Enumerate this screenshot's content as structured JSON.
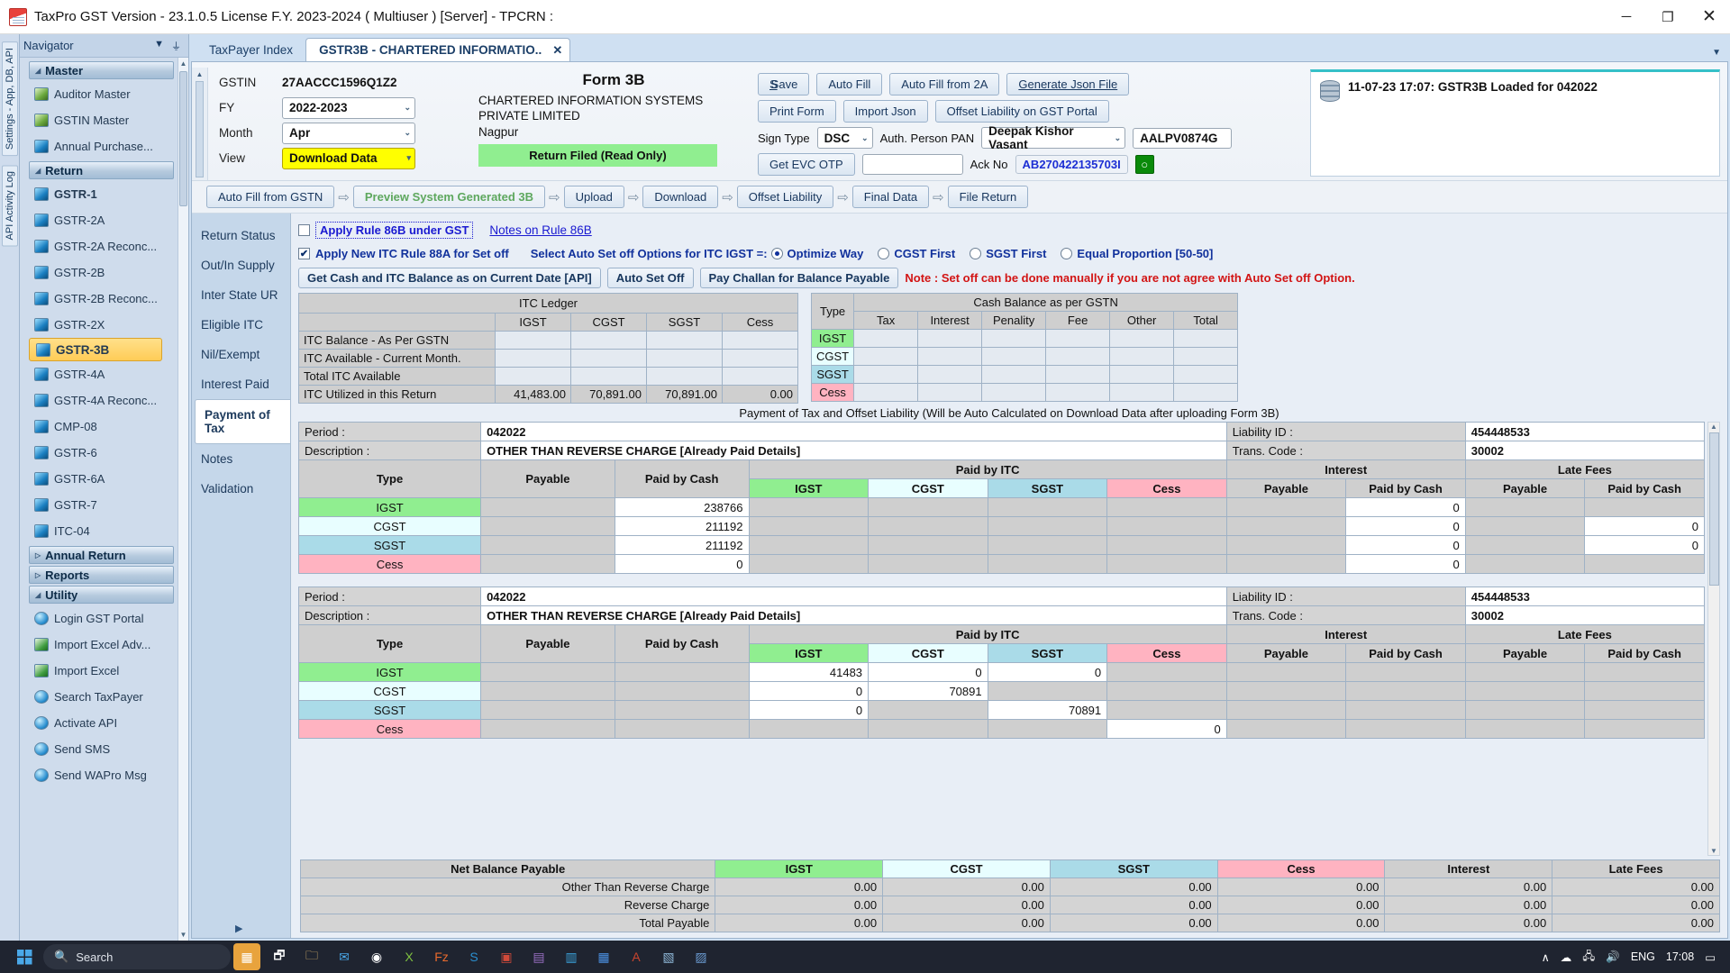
{
  "window": {
    "title": "TaxPro GST Version - 23.1.0.5 License F.Y. 2023-2024 ( Multiuser ) [Server]  - TPCRN :",
    "minimize": "─",
    "maximize": "❐",
    "close": "✕"
  },
  "vstrip": {
    "tabs": [
      "Settings - App, DB, API",
      "API Activity Log"
    ]
  },
  "navigator": {
    "title": "Navigator",
    "chevron": "▼",
    "pin": "⏚",
    "groups": [
      {
        "label": "Master",
        "expanded": true,
        "items": [
          {
            "label": "Auditor Master",
            "icon": "person-icon",
            "bold": false
          },
          {
            "label": "GSTIN Master",
            "icon": "person-icon",
            "bold": false
          },
          {
            "label": "Annual Purchase...",
            "icon": "form-icon",
            "bold": false
          }
        ]
      },
      {
        "label": "Return",
        "expanded": true,
        "items": [
          {
            "label": "GSTR-1",
            "icon": "form-icon",
            "bold": true
          },
          {
            "label": "GSTR-2A",
            "icon": "form-icon",
            "bold": false
          },
          {
            "label": "GSTR-2A Reconc...",
            "icon": "form-icon",
            "bold": false
          },
          {
            "label": "GSTR-2B",
            "icon": "form-icon",
            "bold": false
          },
          {
            "label": "GSTR-2B Reconc...",
            "icon": "form-icon",
            "bold": false
          },
          {
            "label": "GSTR-2X",
            "icon": "form-icon",
            "bold": false
          },
          {
            "label": "GSTR-3B",
            "icon": "form-icon",
            "bold": true,
            "selected": true
          },
          {
            "label": "GSTR-4A",
            "icon": "form-icon",
            "bold": false
          },
          {
            "label": "GSTR-4A Reconc...",
            "icon": "form-icon",
            "bold": false
          },
          {
            "label": "CMP-08",
            "icon": "form-icon",
            "bold": false
          },
          {
            "label": "GSTR-6",
            "icon": "form-icon",
            "bold": false
          },
          {
            "label": "GSTR-6A",
            "icon": "form-icon",
            "bold": false
          },
          {
            "label": "GSTR-7",
            "icon": "form-icon",
            "bold": false
          },
          {
            "label": "ITC-04",
            "icon": "form-icon",
            "bold": false
          }
        ]
      },
      {
        "label": "Annual Return",
        "expanded": false,
        "items": []
      },
      {
        "label": "Reports",
        "expanded": false,
        "items": []
      },
      {
        "label": "Utility",
        "expanded": true,
        "items": [
          {
            "label": "Login GST Portal",
            "icon": "globe-icon",
            "bold": false
          },
          {
            "label": "Import Excel Adv...",
            "icon": "excel-icon",
            "bold": false
          },
          {
            "label": "Import Excel",
            "icon": "excel-icon",
            "bold": false
          },
          {
            "label": "Search TaxPayer",
            "icon": "globe-icon",
            "bold": false
          },
          {
            "label": "Activate API",
            "icon": "globe-icon",
            "bold": false
          },
          {
            "label": "Send SMS",
            "icon": "globe-icon",
            "bold": false
          },
          {
            "label": "Send WAPro Msg",
            "icon": "globe-icon",
            "bold": false
          }
        ]
      }
    ]
  },
  "tabs": [
    {
      "label": "TaxPayer Index",
      "active": false
    },
    {
      "label": "GSTR3B - CHARTERED INFORMATIO..",
      "active": true,
      "close": "✕"
    }
  ],
  "form": {
    "title": "Form 3B",
    "gstin_label": "GSTIN",
    "gstin_value": "27AACCC1596Q1Z2",
    "fy_label": "FY",
    "fy_value": "2022-2023",
    "month_label": "Month",
    "month_value": "Apr",
    "view_label": "View",
    "view_value": "Download Data",
    "company_name": "CHARTERED INFORMATION SYSTEMS PRIVATE LIMITED",
    "company_city": "Nagpur",
    "status_badge": "Return Filed (Read Only)"
  },
  "toolbar": {
    "save": "Save",
    "auto_fill": "Auto Fill",
    "auto_fill_2a": "Auto Fill from 2A",
    "generate_json": "Generate Json File",
    "print_form": "Print Form",
    "import_json": "Import Json",
    "offset_liability_portal": "Offset Liability on GST Portal",
    "sign_type_label": "Sign Type",
    "sign_type_value": "DSC",
    "auth_person_label": "Auth. Person PAN",
    "auth_person_value": "Deepak Kishor Vasant",
    "pan_value": "AALPV0874G",
    "get_evc_otp": "Get EVC OTP",
    "otp_value": "",
    "ack_no_label": "Ack No",
    "ack_no_value": "AB270422135703I",
    "chat_icon": "○"
  },
  "notification": {
    "text": "11-07-23 17:07: GSTR3B Loaded for 042022"
  },
  "wizard": {
    "steps": [
      {
        "label": "Auto Fill from GSTN",
        "state": "normal"
      },
      {
        "label": "Preview System Generated 3B",
        "state": "green"
      },
      {
        "label": "Upload",
        "state": "normal"
      },
      {
        "label": "Download",
        "state": "normal"
      },
      {
        "label": "Offset Liability",
        "state": "normal"
      },
      {
        "label": "Final Data",
        "state": "normal"
      },
      {
        "label": "File Return",
        "state": "normal"
      }
    ],
    "arrow": "⇨"
  },
  "left_tabs": [
    {
      "label": "Return Status",
      "active": false
    },
    {
      "label": "Out/In Supply",
      "active": false
    },
    {
      "label": "Inter State UR",
      "active": false
    },
    {
      "label": "Eligible ITC",
      "active": false
    },
    {
      "label": "Nil/Exempt",
      "active": false
    },
    {
      "label": "Interest Paid",
      "active": false
    },
    {
      "label": "Payment of Tax",
      "active": true
    },
    {
      "label": "Notes",
      "active": false
    },
    {
      "label": "Validation",
      "active": false
    }
  ],
  "rule86b": {
    "checkbox_checked": false,
    "label": "Apply Rule 86B under GST",
    "notes_link": "Notes on Rule 86B"
  },
  "rule88a": {
    "checkbox_checked": true,
    "label": "Apply New ITC Rule 88A for Set off",
    "select_label": "Select Auto Set off Options for ITC IGST =:",
    "options": [
      {
        "label": "Optimize Way",
        "selected": true
      },
      {
        "label": "CGST First",
        "selected": false
      },
      {
        "label": "SGST First",
        "selected": false
      },
      {
        "label": "Equal Proportion [50-50]",
        "selected": false
      }
    ]
  },
  "actions": {
    "get_balance": "Get Cash and ITC Balance as on Current Date [API]",
    "auto_set_off": "Auto Set Off",
    "pay_challan": "Pay Challan for Balance Payable",
    "note": "Note : Set off can be done manually if you are not agree with Auto Set off Option."
  },
  "itc_ledger": {
    "title": "ITC Ledger",
    "columns": [
      "",
      "IGST",
      "CGST",
      "SGST",
      "Cess"
    ],
    "rows": [
      {
        "label": "ITC Balance - As Per GSTN",
        "values": [
          "",
          "",
          "",
          ""
        ]
      },
      {
        "label": "ITC Available - Current Month.",
        "values": [
          "",
          "",
          "",
          ""
        ]
      },
      {
        "label": "Total ITC Available",
        "values": [
          "",
          "",
          "",
          ""
        ]
      },
      {
        "label": "ITC Utilized in this Return",
        "values": [
          "41,483.00",
          "70,891.00",
          "70,891.00",
          "0.00"
        ]
      }
    ]
  },
  "cash_balance": {
    "type_header": "Type",
    "title": "Cash Balance as per GSTN",
    "columns": [
      "Tax",
      "Interest",
      "Penality",
      "Fee",
      "Other",
      "Total"
    ],
    "rows": [
      {
        "type": "IGST",
        "values": [
          "",
          "",
          "",
          "",
          "",
          ""
        ]
      },
      {
        "type": "CGST",
        "values": [
          "",
          "",
          "",
          "",
          "",
          ""
        ]
      },
      {
        "type": "SGST",
        "values": [
          "",
          "",
          "",
          "",
          "",
          ""
        ]
      },
      {
        "type": "Cess",
        "values": [
          "",
          "",
          "",
          "",
          "",
          ""
        ]
      }
    ]
  },
  "payment_note": "Payment of Tax and Offset Liability (Will be Auto Calculated on Download Data after uploading Form 3B)",
  "payment_blocks": [
    {
      "period_label": "Period :",
      "period_value": "042022",
      "liability_label": "Liability ID :",
      "liability_value": "454448533",
      "description_label": "Description :",
      "description_value": "OTHER THAN REVERSE CHARGE [Already Paid Details]",
      "trans_label": "Trans. Code :",
      "trans_value": "30002",
      "group_headers": [
        "Paid by ITC",
        "Interest",
        "Late Fees"
      ],
      "columns": [
        "Type",
        "Payable",
        "Paid by Cash",
        "IGST",
        "CGST",
        "SGST",
        "Cess",
        "Payable",
        "Paid by Cash",
        "Payable",
        "Paid by Cash"
      ],
      "rows": [
        {
          "type": "IGST",
          "payable": "",
          "paid_by_cash": "238766",
          "itc_igst": "",
          "itc_cgst": "",
          "itc_sgst": "",
          "itc_cess": "",
          "int_payable": "",
          "int_paid_cash": "0",
          "lf_payable": "",
          "lf_paid_cash": ""
        },
        {
          "type": "CGST",
          "payable": "",
          "paid_by_cash": "211192",
          "itc_igst": "",
          "itc_cgst": "",
          "itc_sgst": "",
          "itc_cess": "",
          "int_payable": "",
          "int_paid_cash": "0",
          "lf_payable": "",
          "lf_paid_cash": "0"
        },
        {
          "type": "SGST",
          "payable": "",
          "paid_by_cash": "211192",
          "itc_igst": "",
          "itc_cgst": "",
          "itc_sgst": "",
          "itc_cess": "",
          "int_payable": "",
          "int_paid_cash": "0",
          "lf_payable": "",
          "lf_paid_cash": "0"
        },
        {
          "type": "Cess",
          "payable": "",
          "paid_by_cash": "0",
          "itc_igst": "",
          "itc_cgst": "",
          "itc_sgst": "",
          "itc_cess": "",
          "int_payable": "",
          "int_paid_cash": "0",
          "lf_payable": "",
          "lf_paid_cash": ""
        }
      ]
    },
    {
      "period_label": "Period :",
      "period_value": "042022",
      "liability_label": "Liability ID :",
      "liability_value": "454448533",
      "description_label": "Description :",
      "description_value": "OTHER THAN REVERSE CHARGE [Already Paid Details]",
      "trans_label": "Trans. Code :",
      "trans_value": "30002",
      "group_headers": [
        "Paid by ITC",
        "Interest",
        "Late Fees"
      ],
      "columns": [
        "Type",
        "Payable",
        "Paid by Cash",
        "IGST",
        "CGST",
        "SGST",
        "Cess",
        "Payable",
        "Paid by Cash",
        "Payable",
        "Paid by Cash"
      ],
      "rows": [
        {
          "type": "IGST",
          "payable": "",
          "paid_by_cash": "",
          "itc_igst": "41483",
          "itc_cgst": "0",
          "itc_sgst": "0",
          "itc_cess": "",
          "int_payable": "",
          "int_paid_cash": "",
          "lf_payable": "",
          "lf_paid_cash": ""
        },
        {
          "type": "CGST",
          "payable": "",
          "paid_by_cash": "",
          "itc_igst": "0",
          "itc_cgst": "70891",
          "itc_sgst": "",
          "itc_cess": "",
          "int_payable": "",
          "int_paid_cash": "",
          "lf_payable": "",
          "lf_paid_cash": ""
        },
        {
          "type": "SGST",
          "payable": "",
          "paid_by_cash": "",
          "itc_igst": "0",
          "itc_cgst": "",
          "itc_sgst": "70891",
          "itc_cess": "",
          "int_payable": "",
          "int_paid_cash": "",
          "lf_payable": "",
          "lf_paid_cash": ""
        },
        {
          "type": "Cess",
          "payable": "",
          "paid_by_cash": "",
          "itc_igst": "",
          "itc_cgst": "",
          "itc_sgst": "",
          "itc_cess": "0",
          "int_payable": "",
          "int_paid_cash": "",
          "lf_payable": "",
          "lf_paid_cash": ""
        }
      ]
    }
  ],
  "net_balance": {
    "columns": [
      "Net Balance Payable",
      "IGST",
      "CGST",
      "SGST",
      "Cess",
      "Interest",
      "Late Fees"
    ],
    "rows": [
      {
        "label": "Other Than Reverse Charge",
        "values": [
          "0.00",
          "0.00",
          "0.00",
          "0.00",
          "0.00",
          "0.00"
        ]
      },
      {
        "label": "Reverse Charge",
        "values": [
          "0.00",
          "0.00",
          "0.00",
          "0.00",
          "0.00",
          "0.00"
        ]
      },
      {
        "label": "Total Payable",
        "values": [
          "0.00",
          "0.00",
          "0.00",
          "0.00",
          "0.00",
          "0.00"
        ]
      }
    ]
  },
  "taskbar": {
    "search_placeholder": "Search",
    "language": "ENG",
    "time": "17:08",
    "chevron": "∧"
  }
}
